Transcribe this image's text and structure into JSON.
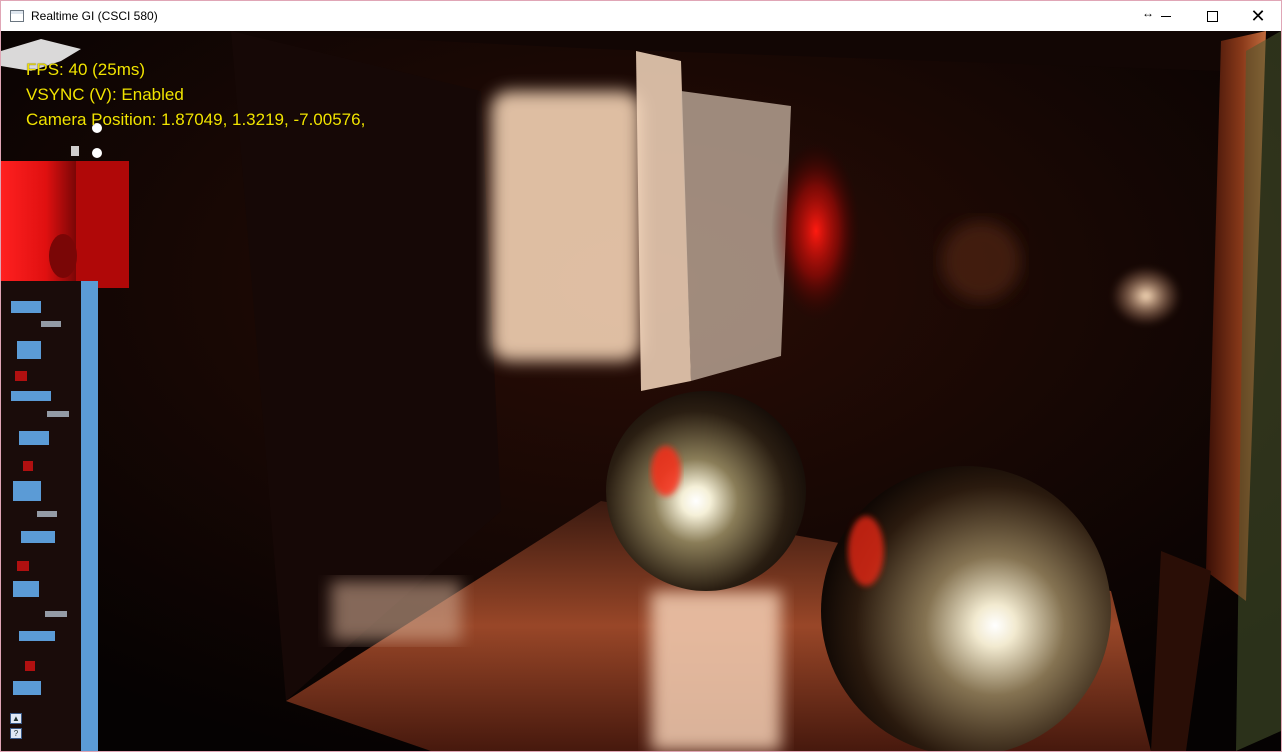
{
  "window": {
    "title": "Realtime GI (CSCI 580)",
    "controls": {
      "minimize_icon": "minimize-icon",
      "maximize_icon": "maximize-icon",
      "close_icon": "close-icon",
      "resize_icon": "resize-arrows-icon"
    }
  },
  "hud": {
    "fps": "FPS: 40 (25ms)",
    "vsync": "VSYNC (V): Enabled",
    "camera": "Camera Position: 1.87049, 1.3219, -7.00576,"
  },
  "colors": {
    "hud_text": "#f2e300",
    "red_cube": "#ff1a1a",
    "side_panel_blue": "#5b9bd6"
  },
  "corner_icons": [
    "up-arrow-icon",
    "help-icon"
  ]
}
